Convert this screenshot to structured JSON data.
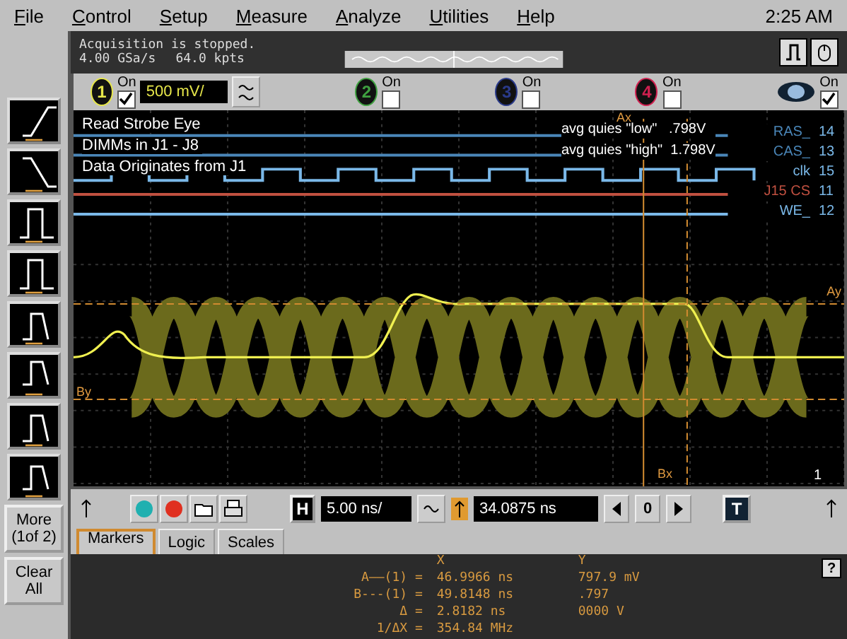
{
  "menu": {
    "items": [
      "File",
      "Control",
      "Setup",
      "Measure",
      "Analyze",
      "Utilities",
      "Help"
    ],
    "time": "2:25 AM"
  },
  "status": {
    "message": "Acquisition is stopped.",
    "sample_rate": "4.00 GSa/s",
    "memory": "64.0 kpts"
  },
  "channels": [
    {
      "number": "1",
      "label": "On",
      "on": true,
      "color": "#e6e64a",
      "scale": "500 mV/"
    },
    {
      "number": "2",
      "label": "On",
      "on": false,
      "color": "#3fa040"
    },
    {
      "number": "3",
      "label": "On",
      "on": false,
      "color": "#2a3a8a"
    },
    {
      "number": "4",
      "label": "On",
      "on": false,
      "color": "#d02050"
    }
  ],
  "digital": {
    "label": "On",
    "on": true
  },
  "display": {
    "notes": [
      "Read Strobe Eye",
      "DIMMs in J1 - J8",
      "Data Originates from J1"
    ],
    "readings": [
      "avg quies \"low\"   .798V",
      "avg quies \"high\"  1.798V"
    ],
    "logic_lines": [
      {
        "name": "RAS_",
        "number": "14",
        "color": "#4a86b8"
      },
      {
        "name": "CAS_",
        "number": "13",
        "color": "#4a86b8"
      },
      {
        "name": "clk",
        "number": "15",
        "color": "#7ab8e8"
      },
      {
        "name": "J15 CS",
        "number": "11",
        "color": "#c05040"
      },
      {
        "name": "WE_",
        "number": "12",
        "color": "#7ab8e8"
      }
    ],
    "marker_labels": [
      "Ax",
      "Bx",
      "Ay",
      "By"
    ],
    "channel_tag": "1"
  },
  "toolbar": {
    "h_label": "H",
    "time_scale": "5.00 ns/",
    "position": "34.0875 ns",
    "center": "0",
    "t_label": "T"
  },
  "more_button": "More (1of 2)",
  "clear_button": "Clear All",
  "tabs": [
    {
      "label": "Markers",
      "selected": true
    },
    {
      "label": "Logic",
      "selected": false
    },
    {
      "label": "Scales",
      "selected": false
    }
  ],
  "markers": {
    "x_heading": "X",
    "y_heading": "Y",
    "help": "?",
    "rows": [
      {
        "label": "A——(1) =",
        "x": "46.9966 ns",
        "y": "797.9 mV"
      },
      {
        "label": "B---(1) =",
        "x": "49.8148 ns",
        "y": ".797"
      },
      {
        "label": "Δ =",
        "x": "2.8182 ns",
        "y": "0000 V"
      },
      {
        "label": "1/ΔX =",
        "x": "354.84 MHz"
      }
    ]
  }
}
